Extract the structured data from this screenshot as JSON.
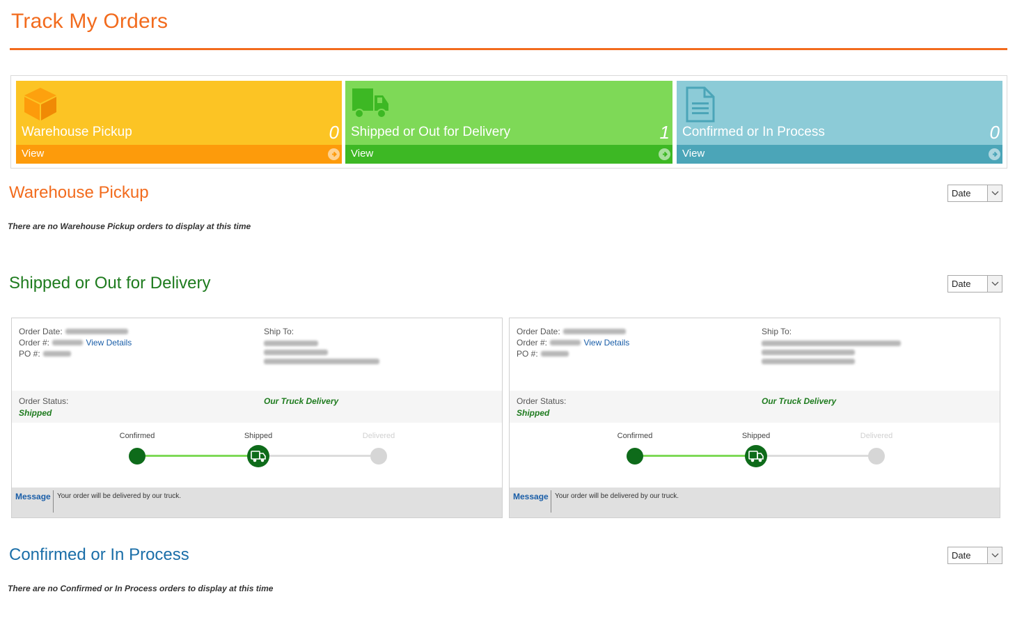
{
  "page": {
    "title": "Track My Orders",
    "accent_color": "#f26b1d"
  },
  "tiles": [
    {
      "label": "Warehouse Pickup",
      "count": "0",
      "view_label": "View",
      "icon": "box-icon",
      "top_color": "#fcc424",
      "bar_color": "#fd9b0b"
    },
    {
      "label": "Shipped or Out for Delivery",
      "count": "1",
      "view_label": "View",
      "icon": "truck-icon",
      "top_color": "#7ed957",
      "bar_color": "#3db824"
    },
    {
      "label": "Confirmed or In Process",
      "count": "0",
      "view_label": "View",
      "icon": "document-icon",
      "top_color": "#8ccbd7",
      "bar_color": "#4ba5b8"
    }
  ],
  "sections": {
    "warehouse": {
      "title": "Warehouse Pickup",
      "sort": "Date",
      "empty_message": "There are no Warehouse Pickup orders to display at this time",
      "title_color": "#f26b1d"
    },
    "shipped": {
      "title": "Shipped or Out for Delivery",
      "sort": "Date",
      "title_color": "#1e7b1e"
    },
    "confirmed": {
      "title": "Confirmed or In Process",
      "sort": "Date",
      "empty_message": "There are no Confirmed or In Process orders to display at this time",
      "title_color": "#1a6ea8"
    }
  },
  "orders": [
    {
      "order_date_label": "Order Date:",
      "order_num_label": "Order #:",
      "view_details": "View Details",
      "po_label": "PO #:",
      "ship_to_label": "Ship To:",
      "status_label": "Order Status:",
      "status": "Shipped",
      "delivery_method": "Our Truck Delivery",
      "steps": [
        "Confirmed",
        "Shipped",
        "Delivered"
      ],
      "message_label": "Message",
      "message": "Your order will be delivered by our truck."
    },
    {
      "order_date_label": "Order Date:",
      "order_num_label": "Order #:",
      "view_details": "View Details",
      "po_label": "PO #:",
      "ship_to_label": "Ship To:",
      "status_label": "Order Status:",
      "status": "Shipped",
      "delivery_method": "Our Truck Delivery",
      "steps": [
        "Confirmed",
        "Shipped",
        "Delivered"
      ],
      "message_label": "Message",
      "message": "Your order will be delivered by our truck."
    }
  ]
}
